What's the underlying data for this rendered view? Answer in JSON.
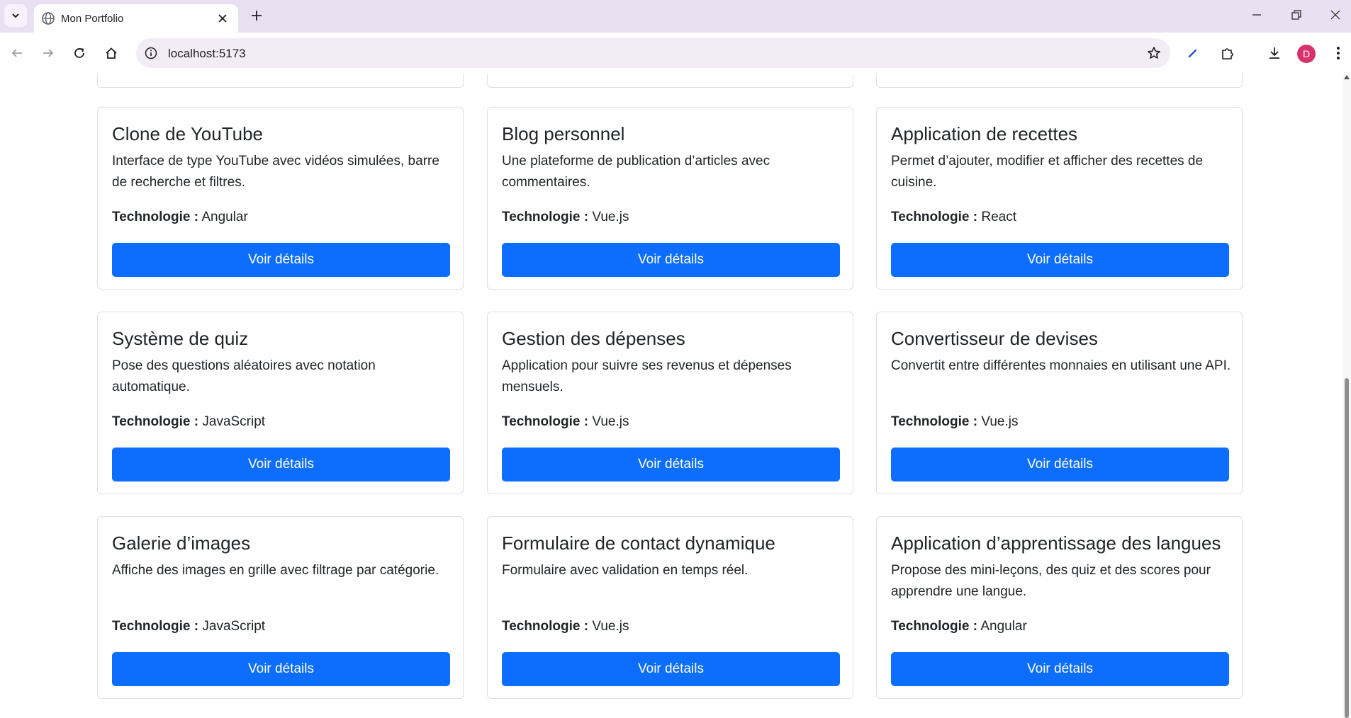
{
  "browser": {
    "tab_title": "Mon Portfolio",
    "url": "localhost:5173",
    "profile_initial": "D"
  },
  "colors": {
    "accent": "#0d6efd",
    "tabstrip": "#e9e0f1",
    "avatar": "#d6336c"
  },
  "projects": [
    {
      "title": "Clone de YouTube",
      "description": "Interface de type YouTube avec vidéos simulées, barre de recherche et filtres.",
      "tech_label": "Technologie :",
      "tech": "Angular",
      "button": "Voir détails"
    },
    {
      "title": "Blog personnel",
      "description": "Une plateforme de publication d’articles avec commentaires.",
      "tech_label": "Technologie :",
      "tech": "Vue.js",
      "button": "Voir détails"
    },
    {
      "title": "Application de recettes",
      "description": "Permet d’ajouter, modifier et afficher des recettes de cuisine.",
      "tech_label": "Technologie :",
      "tech": "React",
      "button": "Voir détails"
    },
    {
      "title": "Système de quiz",
      "description": "Pose des questions aléatoires avec notation automatique.",
      "tech_label": "Technologie :",
      "tech": "JavaScript",
      "button": "Voir détails"
    },
    {
      "title": "Gestion des dépenses",
      "description": "Application pour suivre ses revenus et dépenses mensuels.",
      "tech_label": "Technologie :",
      "tech": "Vue.js",
      "button": "Voir détails"
    },
    {
      "title": "Convertisseur de devises",
      "description": "Convertit entre différentes monnaies en utilisant une API.",
      "tech_label": "Technologie :",
      "tech": "Vue.js",
      "button": "Voir détails"
    },
    {
      "title": "Galerie d’images",
      "description": "Affiche des images en grille avec filtrage par catégorie.",
      "tech_label": "Technologie :",
      "tech": "JavaScript",
      "button": "Voir détails"
    },
    {
      "title": "Formulaire de contact dynamique",
      "description": "Formulaire avec validation en temps réel.",
      "tech_label": "Technologie :",
      "tech": "Vue.js",
      "button": "Voir détails"
    },
    {
      "title": "Application d’apprentissage des langues",
      "description": "Propose des mini-leçons, des quiz et des scores pour apprendre une langue.",
      "tech_label": "Technologie :",
      "tech": "Angular",
      "button": "Voir détails"
    }
  ]
}
